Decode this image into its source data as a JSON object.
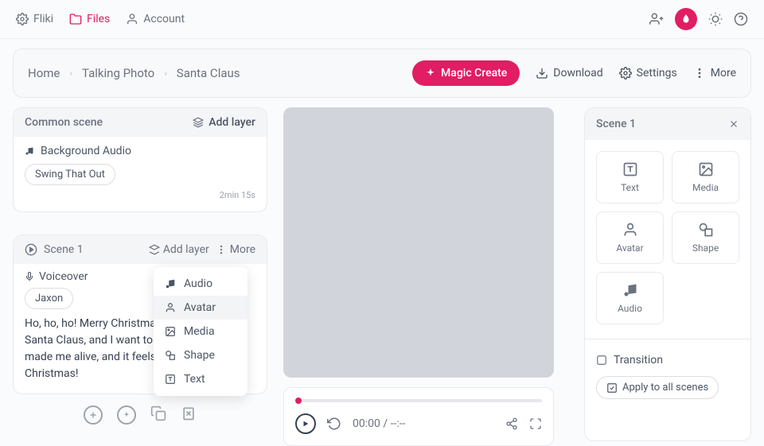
{
  "nav": {
    "brand": "Fliki",
    "files": "Files",
    "account": "Account"
  },
  "breadcrumb": [
    "Home",
    "Talking Photo",
    "Santa Claus"
  ],
  "toolbar": {
    "magic": "Magic Create",
    "download": "Download",
    "settings": "Settings",
    "more": "More"
  },
  "common_scene": {
    "title": "Common scene",
    "add_layer": "Add layer",
    "bg_audio_label": "Background Audio",
    "track": "Swing That Out",
    "duration": "2min 15s"
  },
  "scene": {
    "title": "Scene 1",
    "add_layer": "Add layer",
    "more": "More",
    "voiceover_label": "Voiceover",
    "voice": "Jaxon",
    "script": "Ho, ho, ho! Merry Christmas, everyone! I am Santa Claus, and I want to tell you that AI made me alive, and it feels good! Merry Christmas!"
  },
  "dropdown": {
    "audio": "Audio",
    "avatar": "Avatar",
    "media": "Media",
    "shape": "Shape",
    "text": "Text"
  },
  "player": {
    "time": "00:00 / --:--"
  },
  "right": {
    "title": "Scene 1",
    "tiles": {
      "text": "Text",
      "media": "Media",
      "avatar": "Avatar",
      "shape": "Shape",
      "audio": "Audio"
    },
    "transition": "Transition",
    "apply_all": "Apply to all scenes"
  }
}
